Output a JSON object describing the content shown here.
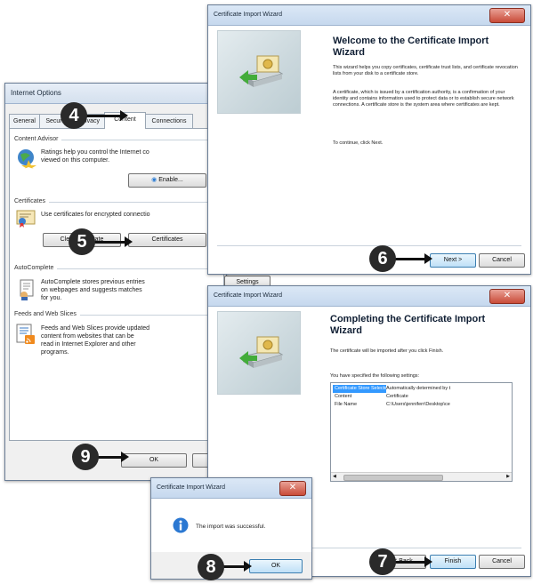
{
  "internet_options": {
    "title": "Internet Options",
    "tabs": [
      "General",
      "Security",
      "Privacy",
      "Content",
      "Connections"
    ],
    "active_tab": "Content",
    "content_advisor": {
      "heading": "Content Advisor",
      "text_line1": "Ratings help you control the Internet co",
      "text_line2": "viewed on this computer.",
      "button": "Enable..."
    },
    "certificates": {
      "heading": "Certificates",
      "text": "Use certificates for encrypted connectio",
      "clear_ssl_button": "Clear SSL state",
      "certificates_button": "Certificates"
    },
    "autocomplete": {
      "heading": "AutoComplete",
      "text_line1": "AutoComplete stores previous entries",
      "text_line2": "on webpages and suggests matches",
      "text_line3": "for you."
    },
    "feeds": {
      "heading": "Feeds and Web Slices",
      "text_line1": "Feeds and Web Slices provide updated",
      "text_line2": "content from websites that can be",
      "text_line3": "read in Internet Explorer and other",
      "text_line4": "programs.",
      "settings_button": "Settings"
    },
    "ok_button": "OK",
    "cancel_button": "Cancel"
  },
  "wizard_welcome": {
    "window_title": "Certificate Import Wizard",
    "heading_line1": "Welcome to the Certificate Import",
    "heading_line2": "Wizard",
    "para1": "This wizard helps you copy certificates, certificate trust lists, and certificate revocation lists from your disk to a certificate store.",
    "para2": "A certificate, which is issued by a certification authority, is a confirmation of your identity and contains information used to protect data or to establish secure network connections. A certificate store is the system area where certificates are kept.",
    "para3": "To continue, click Next.",
    "next_button": "Next >",
    "cancel_button": "Cancel"
  },
  "wizard_complete": {
    "window_title": "Certificate Import Wizard",
    "heading_line1": "Completing the Certificate Import",
    "heading_line2": "Wizard",
    "para1": "The certificate will be imported after you click Finish.",
    "settings_label": "You have specified the following settings:",
    "settings": [
      {
        "key": "Certificate Store Selected",
        "value": "Automatically determined by t"
      },
      {
        "key": "Content",
        "value": "Certificate"
      },
      {
        "key": "File Name",
        "value": "C:\\Users\\jenniferr\\Desktop\\ce"
      }
    ],
    "back_button": "< Back",
    "finish_button": "Finish",
    "cancel_button": "Cancel"
  },
  "success_dialog": {
    "window_title": "Certificate Import Wizard",
    "message": "The import was successful.",
    "ok_button": "OK"
  },
  "callouts": [
    "4",
    "5",
    "6",
    "7",
    "8",
    "9"
  ],
  "colors": {
    "selection": "#3399ff",
    "title_bar": "#c6d8ee",
    "close_button": "#c94b38",
    "callout": "#2a2a2a"
  }
}
